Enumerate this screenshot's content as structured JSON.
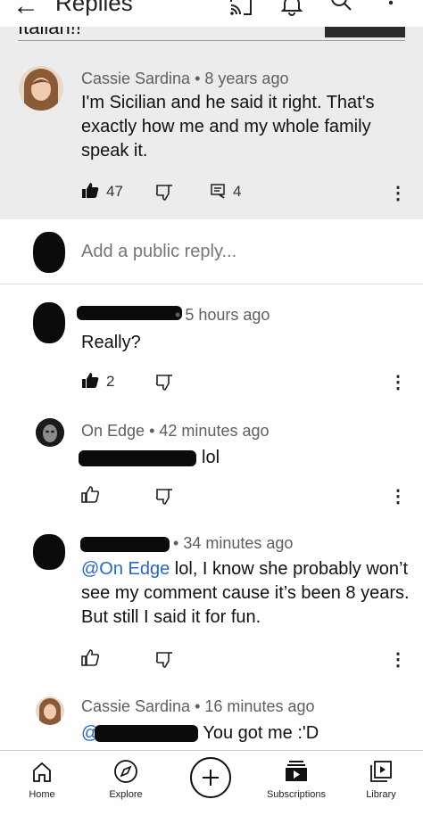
{
  "header": {
    "back_symbol": "←",
    "title": "Replies",
    "icons": [
      "cast-icon",
      "bell-icon",
      "search-icon",
      "more-vertical-icon"
    ]
  },
  "parent_comment_tail": {
    "text": "Italian!!"
  },
  "highlighted_reply": {
    "author": "Cassie Sardina",
    "time": "8 years ago",
    "body": "I'm Sicilian and he said it right. That's exactly how me and my whole family speak it.",
    "likes": "47",
    "replies": "4"
  },
  "add_reply": {
    "placeholder": "Add a public reply..."
  },
  "replies": [
    {
      "author": "",
      "time": "5 hours ago",
      "body": "Really?",
      "likes": "2"
    },
    {
      "author": "On Edge",
      "time": "42 minutes ago",
      "body": "lol",
      "likes": ""
    },
    {
      "author": "",
      "time": "34 minutes ago",
      "mention": "@On Edge",
      "body": " lol, I know she probably won’t see my comment cause it’s been 8 years. But still I said it for fun.",
      "likes": ""
    },
    {
      "author": "Cassie Sardina",
      "time": "16 minutes ago",
      "mention": "@",
      "body": "You got me :'D"
    }
  ],
  "meta_separator": "•",
  "more_symbol": "⋮",
  "bottom_nav": {
    "items": [
      {
        "label": "Home",
        "icon": "home-icon"
      },
      {
        "label": "Explore",
        "icon": "compass-icon"
      },
      {
        "label": "",
        "icon": "add-icon"
      },
      {
        "label": "Subscriptions",
        "icon": "subscriptions-icon"
      },
      {
        "label": "Library",
        "icon": "library-icon"
      }
    ]
  },
  "colors": {
    "highlight_bg": "#ececec",
    "mention": "#2a66c9",
    "meta_text": "#5f5f5f"
  }
}
